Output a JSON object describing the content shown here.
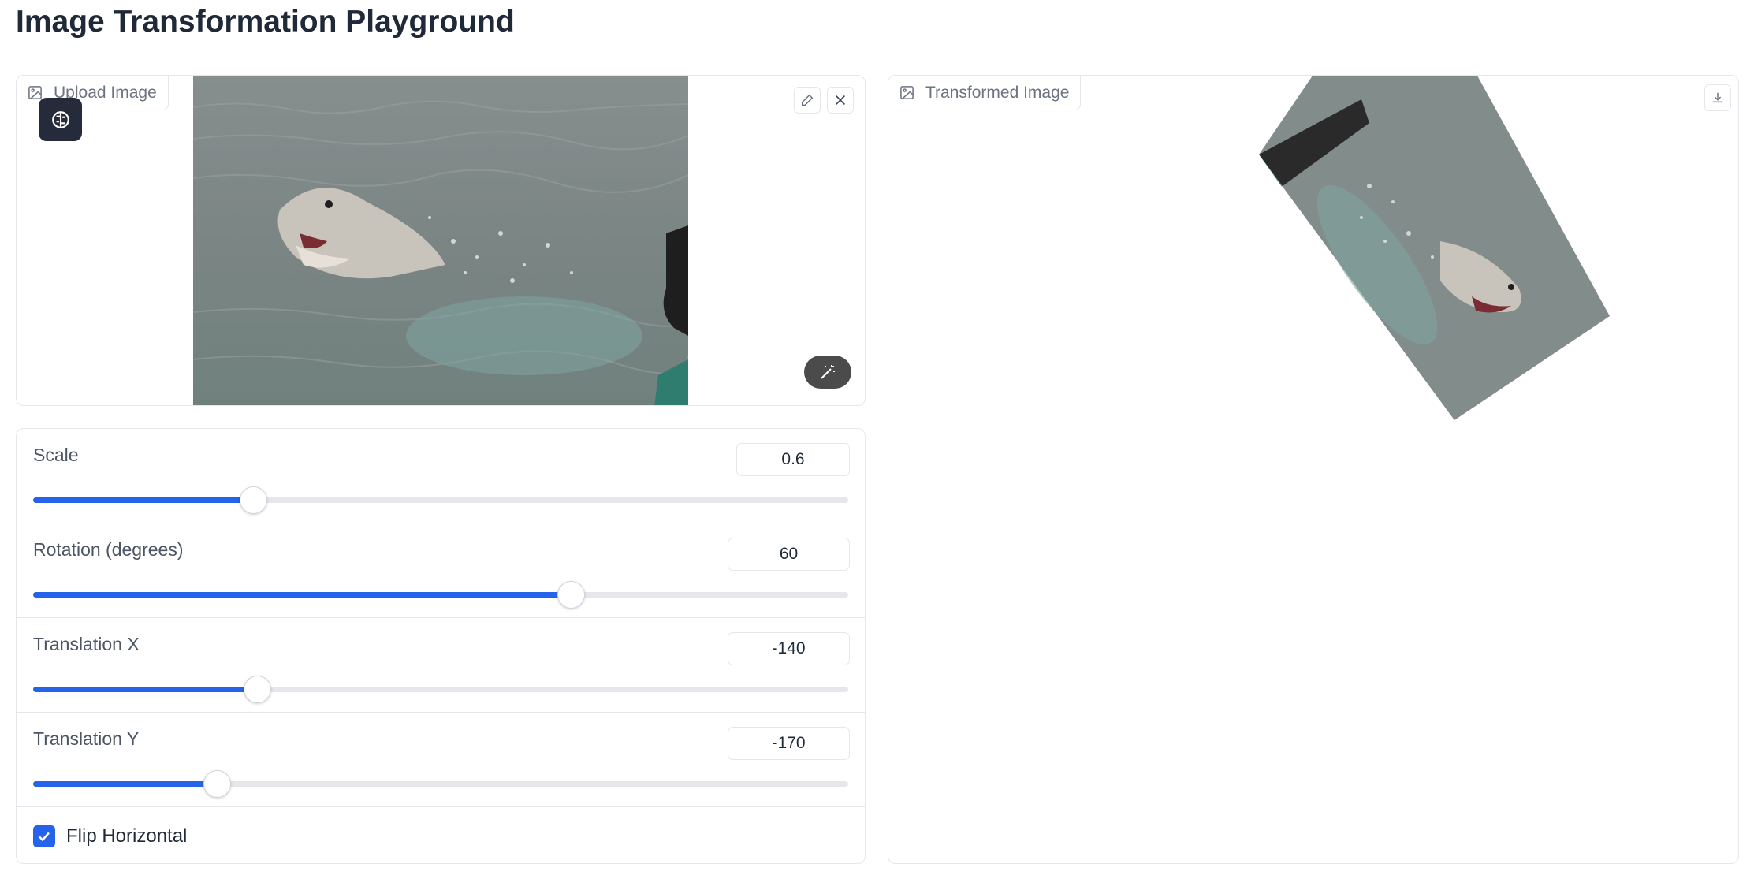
{
  "page": {
    "title": "Image Transformation Playground"
  },
  "input_panel": {
    "label": "Upload Image",
    "label_icon": "image-icon",
    "buttons": {
      "edit_icon": "pencil-icon",
      "clear_icon": "close-icon",
      "brain_icon": "brain-icon",
      "wand_icon": "magic-wand-icon"
    }
  },
  "output_panel": {
    "label": "Transformed Image",
    "label_icon": "image-icon",
    "download_icon": "download-icon"
  },
  "controls": {
    "scale": {
      "label": "Scale",
      "value": "0.6",
      "fill_fraction": 0.27
    },
    "rotation": {
      "label": "Rotation (degrees)",
      "value": "60",
      "fill_fraction": 0.66
    },
    "translation_x": {
      "label": "Translation X",
      "value": "-140",
      "fill_fraction": 0.275
    },
    "translation_y": {
      "label": "Translation Y",
      "value": "-170",
      "fill_fraction": 0.225
    },
    "flip_horizontal": {
      "label": "Flip Horizontal",
      "checked": true
    }
  },
  "colors": {
    "accent": "#2563eb",
    "border": "#e5e7eb",
    "water": "#7d8c8a"
  }
}
